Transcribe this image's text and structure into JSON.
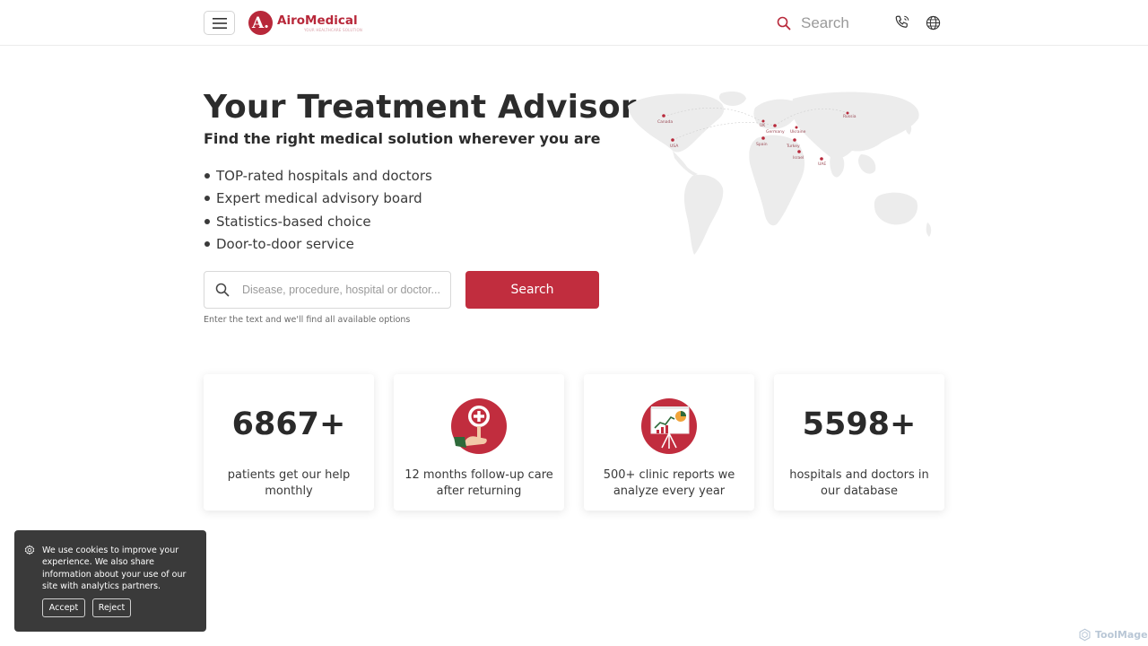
{
  "header": {
    "brand_letter": "A.",
    "brand_name": "AiroMedical",
    "brand_tagline": "YOUR HEALTHCARE SOLUTION",
    "search_label": "Search"
  },
  "hero": {
    "title": "Your Treatment Advisor",
    "subtitle": "Find the right medical solution wherever you are",
    "bullets": [
      "TOP-rated hospitals and doctors",
      "Expert medical advisory board",
      "Statistics-based choice",
      "Door-to-door service"
    ],
    "search_placeholder": "Disease, procedure, hospital or doctor...",
    "search_button": "Search",
    "hint": "Enter the text and we'll find all available options"
  },
  "map": {
    "labels": [
      "Germany",
      "Ukraine",
      "Spain",
      "Turkey",
      "Israel",
      "Russia",
      "USA",
      "Canada",
      "UAE",
      "UK"
    ]
  },
  "stats": [
    {
      "value": "6867+",
      "description": "patients get our help monthly"
    },
    {
      "icon": "magnifier-plus-icon",
      "description": "12 months follow-up care after returning"
    },
    {
      "icon": "chart-board-icon",
      "description": "500+ clinic reports we analyze every year"
    },
    {
      "value": "5598+",
      "description": "hospitals and doctors in our database"
    }
  ],
  "cookie": {
    "text": "We use cookies to improve your experience. We also share information about your use of our site with analytics partners.",
    "accept": "Accept",
    "reject": "Reject"
  },
  "watermark": "ToolMage",
  "colors": {
    "brand_red": "#c12d3e",
    "text_dark": "#2c2c2c",
    "banner_bg": "#3a3a3a"
  }
}
